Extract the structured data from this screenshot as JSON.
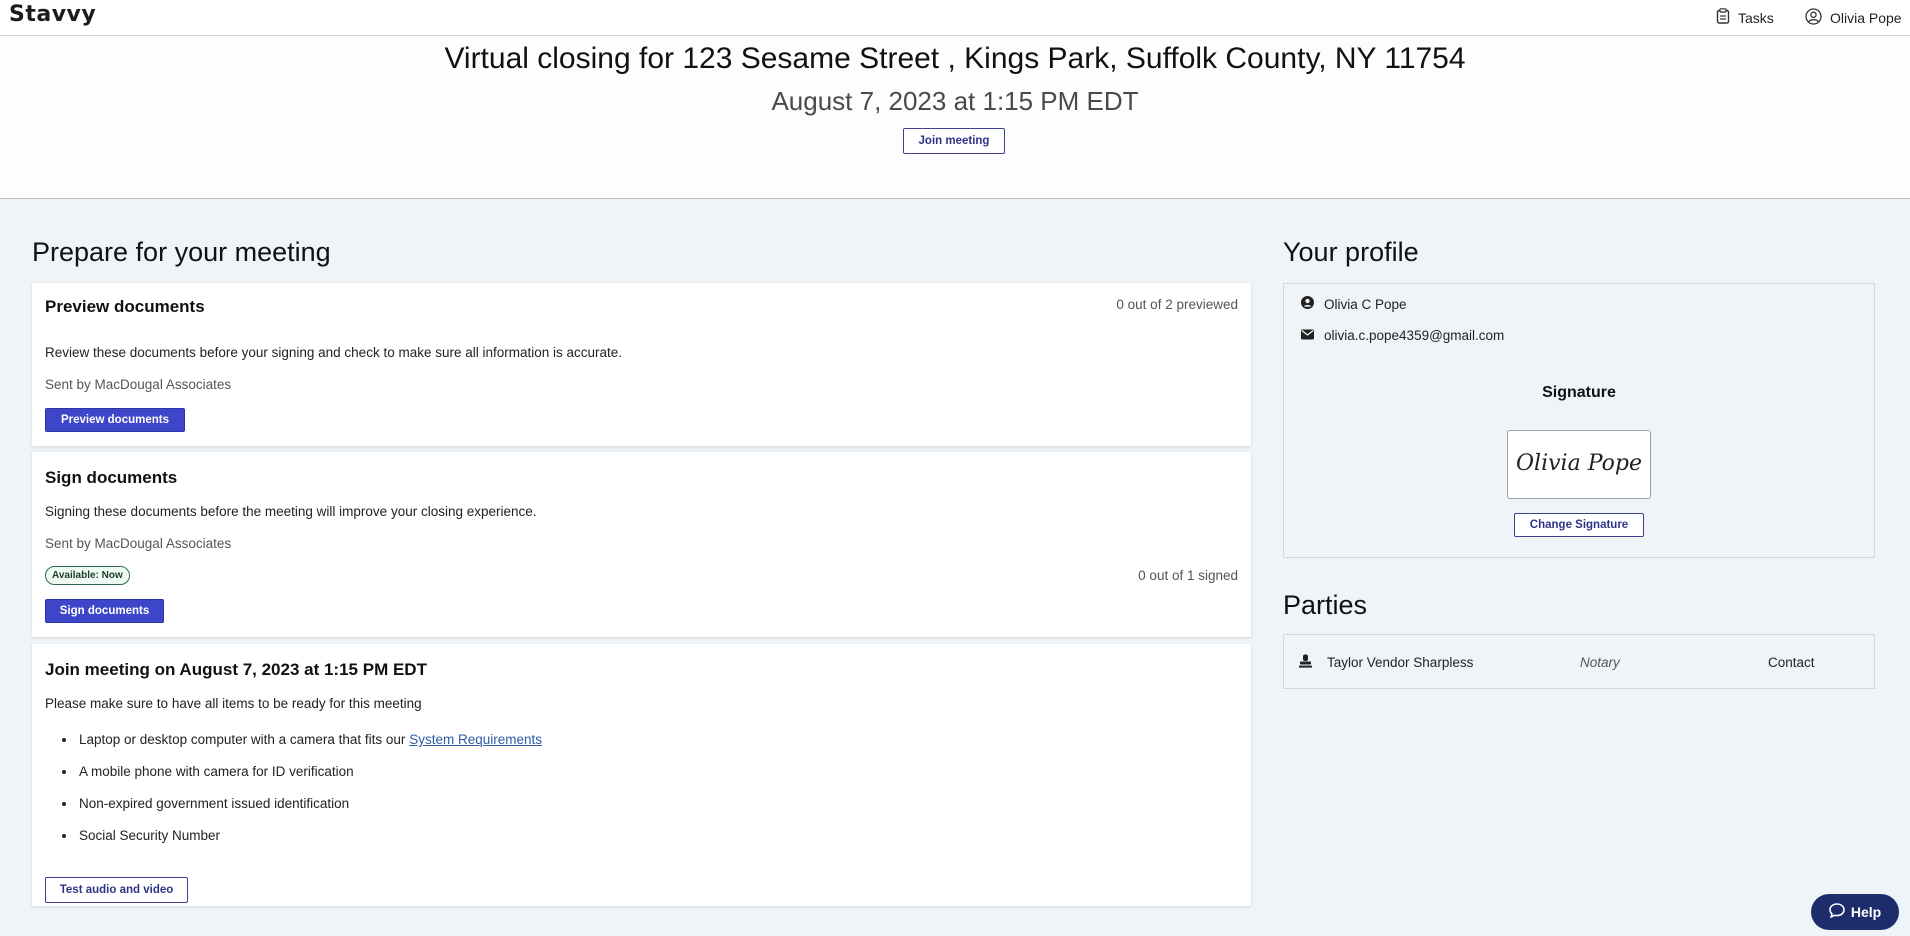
{
  "header": {
    "logo": "Stavvy",
    "tasks_label": "Tasks",
    "user_name": "Olivia Pope"
  },
  "hero": {
    "title": "Virtual closing for 123 Sesame Street , Kings Park, Suffolk County, NY 11754",
    "date": "August 7, 2023 at 1:15 PM EDT",
    "join_label": "Join meeting"
  },
  "prepare": {
    "heading": "Prepare for your meeting",
    "preview": {
      "title": "Preview documents",
      "count": "0 out of 2 previewed",
      "description": "Review these documents before your signing and check to make sure all information is accurate.",
      "sent_by": "Sent by MacDougal Associates",
      "button": "Preview documents"
    },
    "sign": {
      "title": "Sign documents",
      "description": "Signing these documents before the meeting will improve your closing experience.",
      "sent_by": "Sent by MacDougal Associates",
      "badge": "Available: Now",
      "count": "0 out of 1 signed",
      "button": "Sign documents"
    },
    "meeting": {
      "title": "Join meeting on August 7, 2023 at 1:15 PM EDT",
      "intro": "Please make sure to have all items to be ready for this meeting",
      "item1_prefix": "Laptop or desktop computer with a camera that fits our",
      "item1_link": "System Requirements",
      "item2": "A mobile phone with camera for ID verification",
      "item3": "Non-expired government issued identification",
      "item4": "Social Security Number",
      "button": "Test audio and video"
    }
  },
  "profile": {
    "heading": "Your profile",
    "name": "Olivia C Pope",
    "email": "olivia.c.pope4359@gmail.com",
    "signature_heading": "Signature",
    "signature_text": "Olivia Pope",
    "change_button": "Change Signature"
  },
  "parties": {
    "heading": "Parties",
    "rows": [
      {
        "name": "Taylor Vendor Sharpless",
        "role": "Notary",
        "action": "Contact"
      }
    ]
  },
  "help": {
    "label": "Help"
  },
  "colors": {
    "primary": "#3d45c9",
    "help_bg": "#1d2c6b",
    "link": "#2d5aa7",
    "page_bg": "#eef4f7"
  }
}
